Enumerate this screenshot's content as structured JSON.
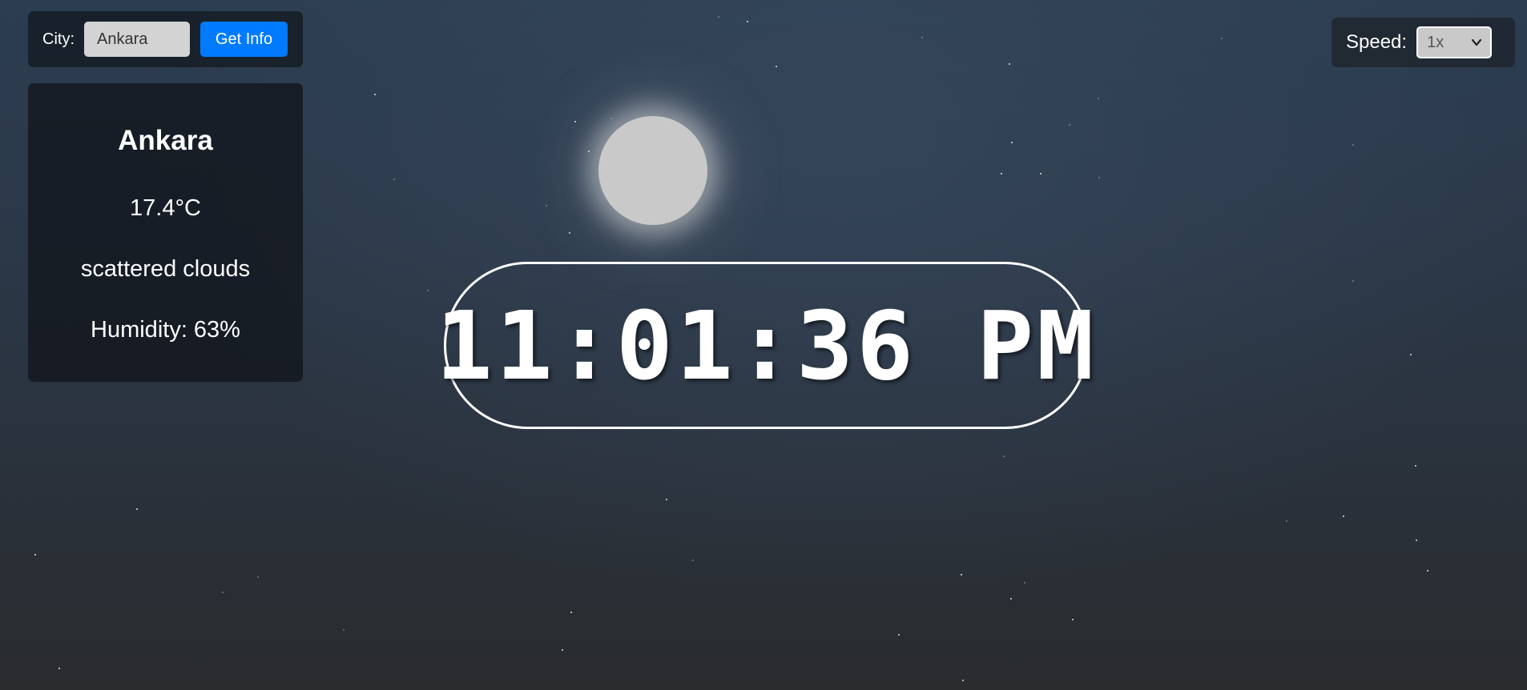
{
  "search": {
    "label": "City:",
    "value": "Ankara",
    "button_label": "Get Info"
  },
  "weather": {
    "city": "Ankara",
    "temperature": "17.4°C",
    "description": "scattered clouds",
    "humidity": "Humidity: 63%"
  },
  "clock": {
    "time": "11:01:36 PM"
  },
  "speed": {
    "label": "Speed:",
    "selected": "1x"
  },
  "colors": {
    "accent": "#007bff",
    "sky_top": "#2c3d51",
    "sky_bottom": "#2a2c2e",
    "moon": "#c9c9c9"
  },
  "icons": {
    "speed_dropdown": "chevron-down-icon",
    "moon": "moon-icon"
  }
}
